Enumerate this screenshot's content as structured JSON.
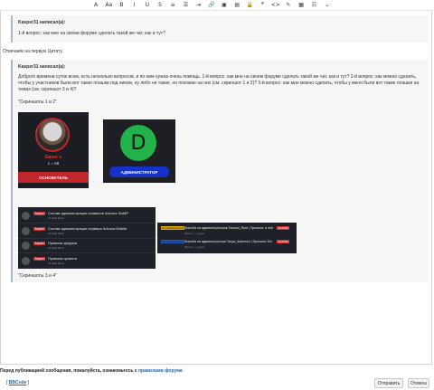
{
  "toolbar": {
    "buttons": [
      {
        "name": "font-size-button",
        "glyph": "A"
      },
      {
        "name": "font-case-button",
        "glyph": "Aa"
      },
      {
        "name": "bold-button",
        "glyph": "B"
      },
      {
        "name": "italic-button",
        "glyph": "I"
      },
      {
        "name": "underline-button",
        "glyph": "U"
      },
      {
        "name": "strike-button",
        "glyph": "S"
      },
      {
        "name": "align-button",
        "glyph": "≡"
      },
      {
        "name": "list-button",
        "glyph": "☰"
      },
      {
        "name": "indent-button",
        "glyph": "⇥"
      },
      {
        "name": "link-button",
        "glyph": "🔗"
      },
      {
        "name": "image-button",
        "glyph": "▣"
      },
      {
        "name": "media-button",
        "glyph": "▤"
      },
      {
        "name": "spoiler-button",
        "glyph": "🔒"
      },
      {
        "name": "quote-button",
        "glyph": "❞"
      },
      {
        "name": "code-button",
        "glyph": "<>"
      },
      {
        "name": "color-button",
        "glyph": "✎"
      },
      {
        "name": "table-button",
        "glyph": "▦"
      },
      {
        "name": "more-button",
        "glyph": "☷"
      },
      {
        "name": "dropdown-button",
        "glyph": "⌄"
      }
    ]
  },
  "post": {
    "quote1": {
      "author": "Kasper31 написал(а):",
      "text": "1-й вопрос: как мне на своем форуме сделать такой же чат, как и тут?"
    },
    "reply1": "Отвечаем на первую Цитату.",
    "quote2": {
      "author": "Kasper31 написал(а):",
      "text": "Доброго времени суток всем, есть несколько вопросов, и по ним нужна очень помощь. 1-й вопрос: как мне на своем форуме сделать такой же чат, как и тут? 2-й вопрос: как можно сделать, чтобы у участников были вот такие плашки под ником, ну либо не такие, но похожие на них (см. скриншот 1 и 2)? 3-й вопрос: как мне можно сделать, чтобы у меня были вот такие плашки на темах (см. скриншот 3 и 4)?",
      "caption12": "\"Скриншоты 1 и 2\"",
      "caption34": "\"Скриншоты 3 и 4\""
    },
    "screenshot1": {
      "name_line": "Gaser ●",
      "level": "1 = 68",
      "badge": "ОСНОВАТЕЛЬ",
      "accent": "#c0262a"
    },
    "screenshot2": {
      "avatar_letter": "D",
      "badge": "АДМИНИСТРАТОР",
      "avatar_color": "#21b24a",
      "badge_color": "#1432c8"
    },
    "screenshot3": {
      "rows": [
        {
          "tag": "Закреп",
          "title": "Состав администрации серверов Arizona SAMP.",
          "meta": "21 Мар 2014"
        },
        {
          "tag": "Закреп",
          "title": "Состав администрации сервера Arizona Mobile.",
          "meta": "14 Мар 2022"
        },
        {
          "tag": "Закреп",
          "title": "Правила форума",
          "meta": "16 Мар 2017"
        },
        {
          "tag": "Закреп",
          "title": "Правила проекта",
          "meta": "21 Мар 2014"
        }
      ]
    },
    "screenshot4": {
      "rows": [
        {
          "tag": "На рассмотрении",
          "title": "Жалоба на администраторов Tsutomi_Ricci | Причина: в ней",
          "badge": "ЖАЛОБА"
        },
        {
          "tag": "На рассмотрении",
          "title": "Жалоба на администратора Tanya_Adamson | Причина: бот",
          "badge": "ЖАЛОБА"
        }
      ],
      "meta_line": "Игрок 1 · 1 день"
    }
  },
  "footer": {
    "note_prefix": "Перед публикацией сообщения, пожалуйста, ознакомьтесь с ",
    "note_link": "правилами форума",
    "bbcode_open": "[",
    "bbcode_label": "BBCode",
    "bbcode_close": "]",
    "submit_label": "Отправить",
    "cancel_label": "Отмена"
  }
}
